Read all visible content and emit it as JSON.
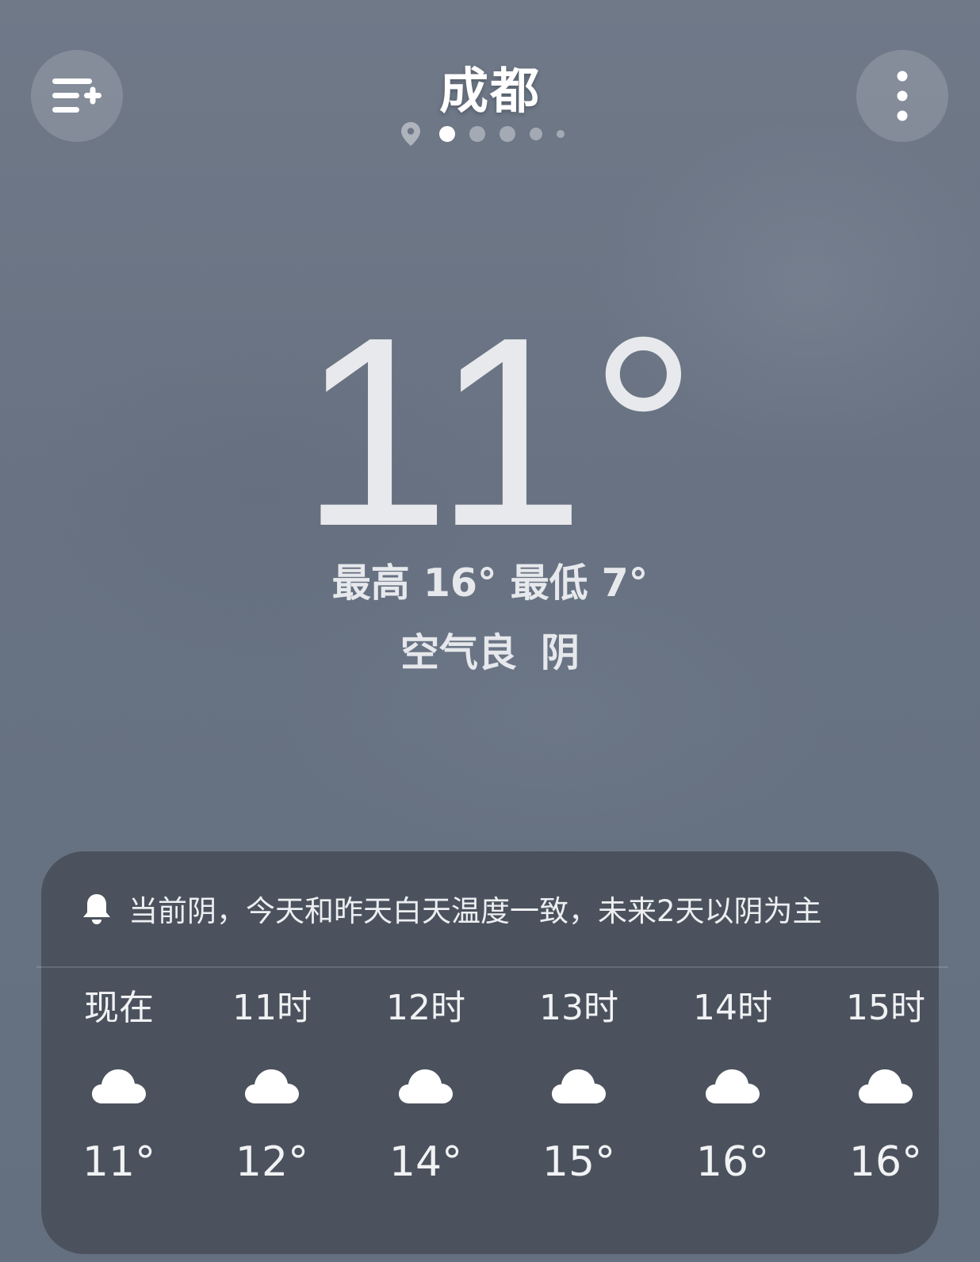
{
  "header": {
    "city": "成都",
    "add_icon": "list-add-icon",
    "more_icon": "more-vertical-icon",
    "location_icon": "location-pin-icon",
    "page_count": 5,
    "active_page": 1
  },
  "current": {
    "temperature": "11°",
    "hi_label": "最高 16°",
    "lo_label": "最低 7°",
    "air_quality": "空气良",
    "condition": "阴"
  },
  "forecast_card": {
    "alert_icon": "bell-icon",
    "alert_text": "当前阴，今天和昨天白天温度一致，未来2天以阴为主",
    "hours": [
      {
        "label": "现在",
        "icon": "cloud-icon",
        "temp": "11°"
      },
      {
        "label": "11时",
        "icon": "cloud-icon",
        "temp": "12°"
      },
      {
        "label": "12时",
        "icon": "cloud-icon",
        "temp": "14°"
      },
      {
        "label": "13时",
        "icon": "cloud-icon",
        "temp": "15°"
      },
      {
        "label": "14时",
        "icon": "cloud-icon",
        "temp": "16°"
      },
      {
        "label": "15时",
        "icon": "cloud-icon",
        "temp": "16°"
      }
    ]
  },
  "colors": {
    "background": "#677181",
    "card": "#4b525d",
    "text": "#eceef1"
  }
}
